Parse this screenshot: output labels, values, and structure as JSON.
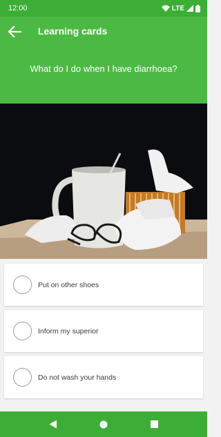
{
  "status_bar": {
    "time": "12:00",
    "network": "LTE",
    "icons": [
      "wifi-icon",
      "signal-icon",
      "battery-icon"
    ]
  },
  "header": {
    "back_icon": "arrow-left-icon",
    "title": "Learning cards",
    "question": "What do I do when I have diarrhoea?"
  },
  "image": {
    "description_icon": "mug-tissues-glasses-photo"
  },
  "answers": [
    {
      "label": "Put on other shoes",
      "selected": false
    },
    {
      "label": "Inform my superior",
      "selected": false
    },
    {
      "label": "Do not wash your hands",
      "selected": false
    }
  ],
  "nav": {
    "icons": [
      "back-triangle-icon",
      "home-circle-icon",
      "recents-square-icon"
    ]
  },
  "colors": {
    "header_green": "#4cb944",
    "bar_green": "#3cae35",
    "background": "#f2f2f2"
  }
}
